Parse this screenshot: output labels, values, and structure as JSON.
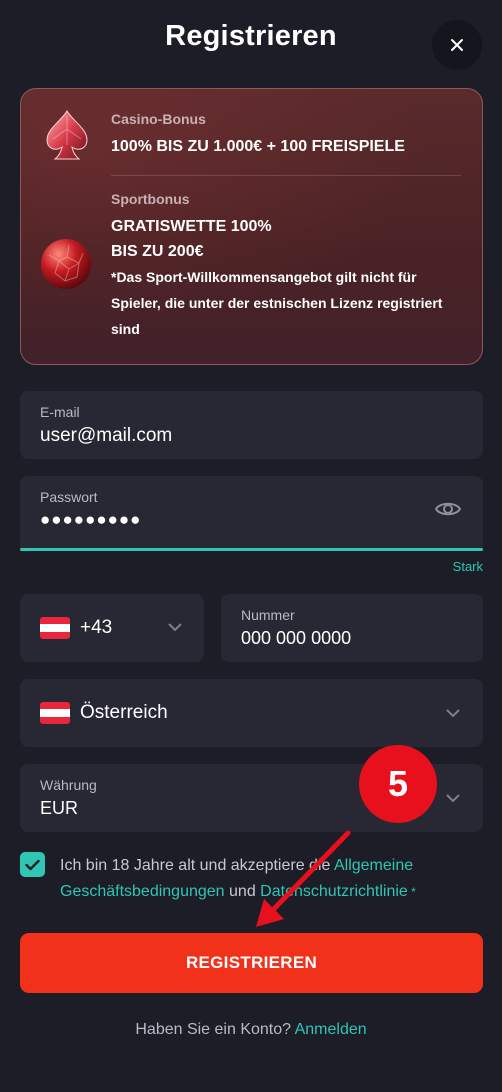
{
  "header": {
    "title": "Registrieren"
  },
  "bonus": {
    "casino_label": "Casino-Bonus",
    "casino_value": "100% BIS ZU 1.000€ + 100 FREISPIELE",
    "sport_label": "Sportbonus",
    "sport_line1": "GRATISWETTE 100%",
    "sport_line2": "BIS ZU 200€",
    "sport_note": "*Das Sport-Willkommensangebot gilt nicht für Spieler, die unter der estnischen Lizenz registriert sind"
  },
  "form": {
    "email_label": "E-mail",
    "email_value": "user@mail.com",
    "password_label": "Passwort",
    "password_value": "●●●●●●●●●",
    "password_strength": "Stark",
    "phone_code": "+43",
    "number_label": "Nummer",
    "number_value": "000 000 0000",
    "country_value": "Österreich",
    "currency_label": "Währung",
    "currency_value": "EUR"
  },
  "terms": {
    "text_before": "Ich bin 18 Jahre alt und akzeptiere die ",
    "link_terms": "Allgemeine Geschäftsbedingungen",
    "text_middle": " und ",
    "link_privacy": "Datenschutzrichtlinie",
    "required_mark": " *"
  },
  "register_label": "REGISTRIEREN",
  "login": {
    "prompt": "Haben Sie ein Konto? ",
    "link": "Anmelden"
  },
  "annotation": {
    "step_number": "5"
  },
  "colors": {
    "accent": "#2fc6b4",
    "primary_button": "#f2311a",
    "background": "#1c1d26",
    "field": "#272833",
    "badge": "#e8101c"
  },
  "icons": {
    "close": "close-icon",
    "eye": "eye-icon",
    "chevron": "chevron-down-icon",
    "check": "check-icon",
    "flag": "austria-flag-icon"
  }
}
